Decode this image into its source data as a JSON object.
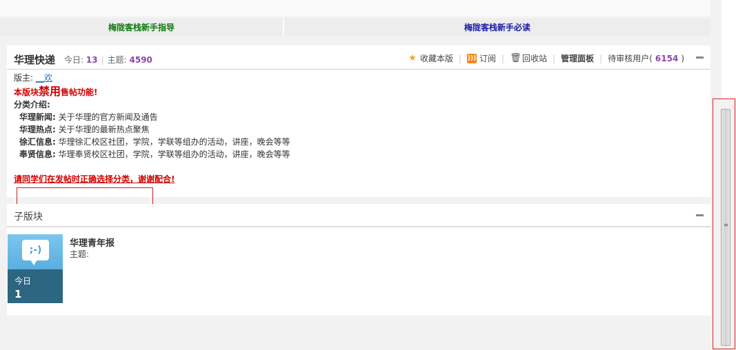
{
  "guide": {
    "left_link": "梅陇客栈新手指导",
    "right_link": "梅陇客栈新手必读"
  },
  "forum": {
    "title": "华理快递",
    "today_label": "今日:",
    "today_value": "13",
    "topics_label": "主题:",
    "topics_value": "4590",
    "actions": {
      "favorite": "收藏本版",
      "subscribe": "订阅",
      "recycle": "回收站",
      "manage": "管理面板",
      "pending_label": "待审核用户(",
      "pending_value": "6154",
      "pending_close": ")"
    },
    "moderator_label": "版主:",
    "moderator_name": "__欢",
    "notice_pre": "本版块",
    "notice_big": "禁用",
    "notice_post": "售帖功能!",
    "categories_title": "分类介绍:",
    "categories": [
      {
        "name": "华理新闻:",
        "desc": "关于华理的官方新闻及通告"
      },
      {
        "name": "华理热点:",
        "desc": "关于华理的最新热点聚焦"
      },
      {
        "name": "徐汇信息:",
        "desc": "华理徐汇校区社团，学院，学联等组办的活动，讲座，晚会等等"
      },
      {
        "name": "奉贤信息:",
        "desc": "华理奉贤校区社团，学院，学联等组办的活动，讲座，晚会等等"
      }
    ],
    "bottom_notice": "请同学们在发帖时正确选择分类，谢谢配合!"
  },
  "subforum": {
    "title": "子版块",
    "tile_label": "今日",
    "tile_count": "1",
    "board_name": "华理青年报",
    "board_topics": "主题:"
  }
}
